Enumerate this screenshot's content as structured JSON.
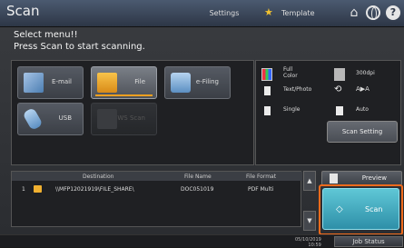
{
  "header": {
    "title": "Scan",
    "settings_label": "Settings",
    "template_label": "Template",
    "help_label": "?"
  },
  "message": {
    "line1": "Select menu!!",
    "line2": "Press Scan to start scanning."
  },
  "functions": [
    {
      "label": "E-mail",
      "icon": "email-icon"
    },
    {
      "label": "File",
      "icon": "folder-icon",
      "selected": true
    },
    {
      "label": "e-Filing",
      "icon": "e-filing-icon"
    },
    {
      "label": "USB",
      "icon": "usb-icon"
    },
    {
      "label": "WS Scan",
      "icon": "ws-scan-icon",
      "disabled": true
    }
  ],
  "options": {
    "color_line1": "Full",
    "color_line2": "Color",
    "resolution": "300dpi",
    "mode": "Text/Photo",
    "rotation": "A▶A",
    "sides": "Single",
    "size": "Auto",
    "scan_setting_label": "Scan Setting"
  },
  "destinations": {
    "headers": {
      "destination": "Destination",
      "filename": "File Name",
      "format": "File Format"
    },
    "rows": [
      {
        "num": "1",
        "destination": "\\\\MFP12021919\\FILE_SHARE\\",
        "filename": "DOC051019",
        "format": "PDF Multi"
      }
    ]
  },
  "scroll": {
    "up": "▲",
    "down": "▼"
  },
  "preview_label": "Preview",
  "scan_label": "Scan",
  "footer": {
    "date": "05/10/2019",
    "time": "10:59",
    "job_status_label": "Job Status"
  },
  "colors": {
    "accent": "#f06a1c",
    "scan": "#3ab0c4",
    "star": "#f2c230"
  }
}
